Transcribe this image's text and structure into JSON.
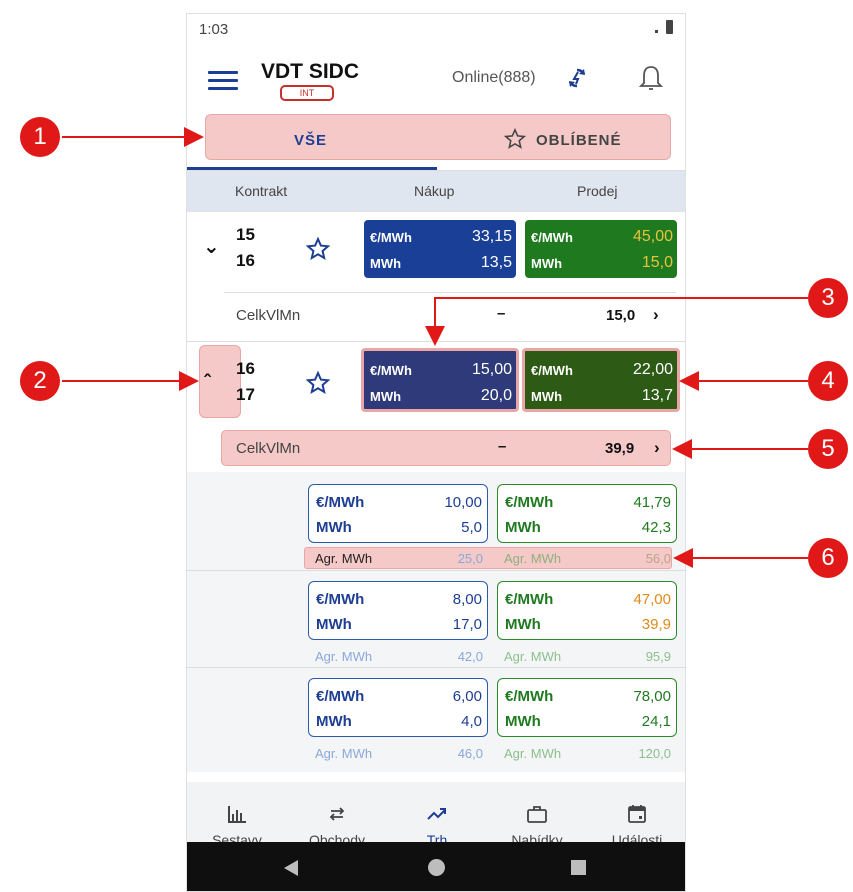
{
  "status": {
    "time": "1:03"
  },
  "header": {
    "title": "VDT SIDC",
    "badge": "INT",
    "online": "Online(888)"
  },
  "tabs": [
    {
      "label": "VŠE"
    },
    {
      "label": "OBLÍBENÉ"
    }
  ],
  "columns": {
    "contract": "Kontrakt",
    "buy": "Nákup",
    "sell": "Prodej"
  },
  "units": {
    "price": "€/MWh",
    "volume": "MWh",
    "agr": "Agr. MWh"
  },
  "contracts": [
    {
      "from": "15",
      "to": "16",
      "buy_price": "33,15",
      "buy_volume": "13,5",
      "sell_price": "45,00",
      "sell_volume": "15,0",
      "sub_label": "CelkVlMn",
      "sub_dash": "–",
      "sub_value": "15,0"
    },
    {
      "from": "16",
      "to": "17",
      "buy_price": "15,00",
      "buy_volume": "20,0",
      "sell_price": "22,00",
      "sell_volume": "13,7",
      "sub_label": "CelkVlMn",
      "sub_dash": "–",
      "sub_value": "39,9"
    }
  ],
  "depth": [
    {
      "buy_price": "10,00",
      "buy_volume": "5,0",
      "sell_price": "41,79",
      "sell_volume": "42,3",
      "agr_buy": "25,0",
      "agr_sell": "56,0"
    },
    {
      "buy_price": "8,00",
      "buy_volume": "17,0",
      "sell_price": "47,00",
      "sell_volume": "39,9",
      "agr_buy": "42,0",
      "agr_sell": "95,9"
    },
    {
      "buy_price": "6,00",
      "buy_volume": "4,0",
      "sell_price": "78,00",
      "sell_volume": "24,1",
      "agr_buy": "46,0",
      "agr_sell": "120,0"
    }
  ],
  "bottom_nav": [
    {
      "label": "Sestavy"
    },
    {
      "label": "Obchody"
    },
    {
      "label": "Trh"
    },
    {
      "label": "Nabídky"
    },
    {
      "label": "Události"
    }
  ],
  "annotations": [
    "1",
    "2",
    "3",
    "4",
    "5",
    "6"
  ],
  "colors": {
    "accent": "#1d3e92",
    "buy": "#1a3f96",
    "sell": "#1f7a1f",
    "annotation": "#e01818",
    "highlight": "#f6c9c9"
  }
}
